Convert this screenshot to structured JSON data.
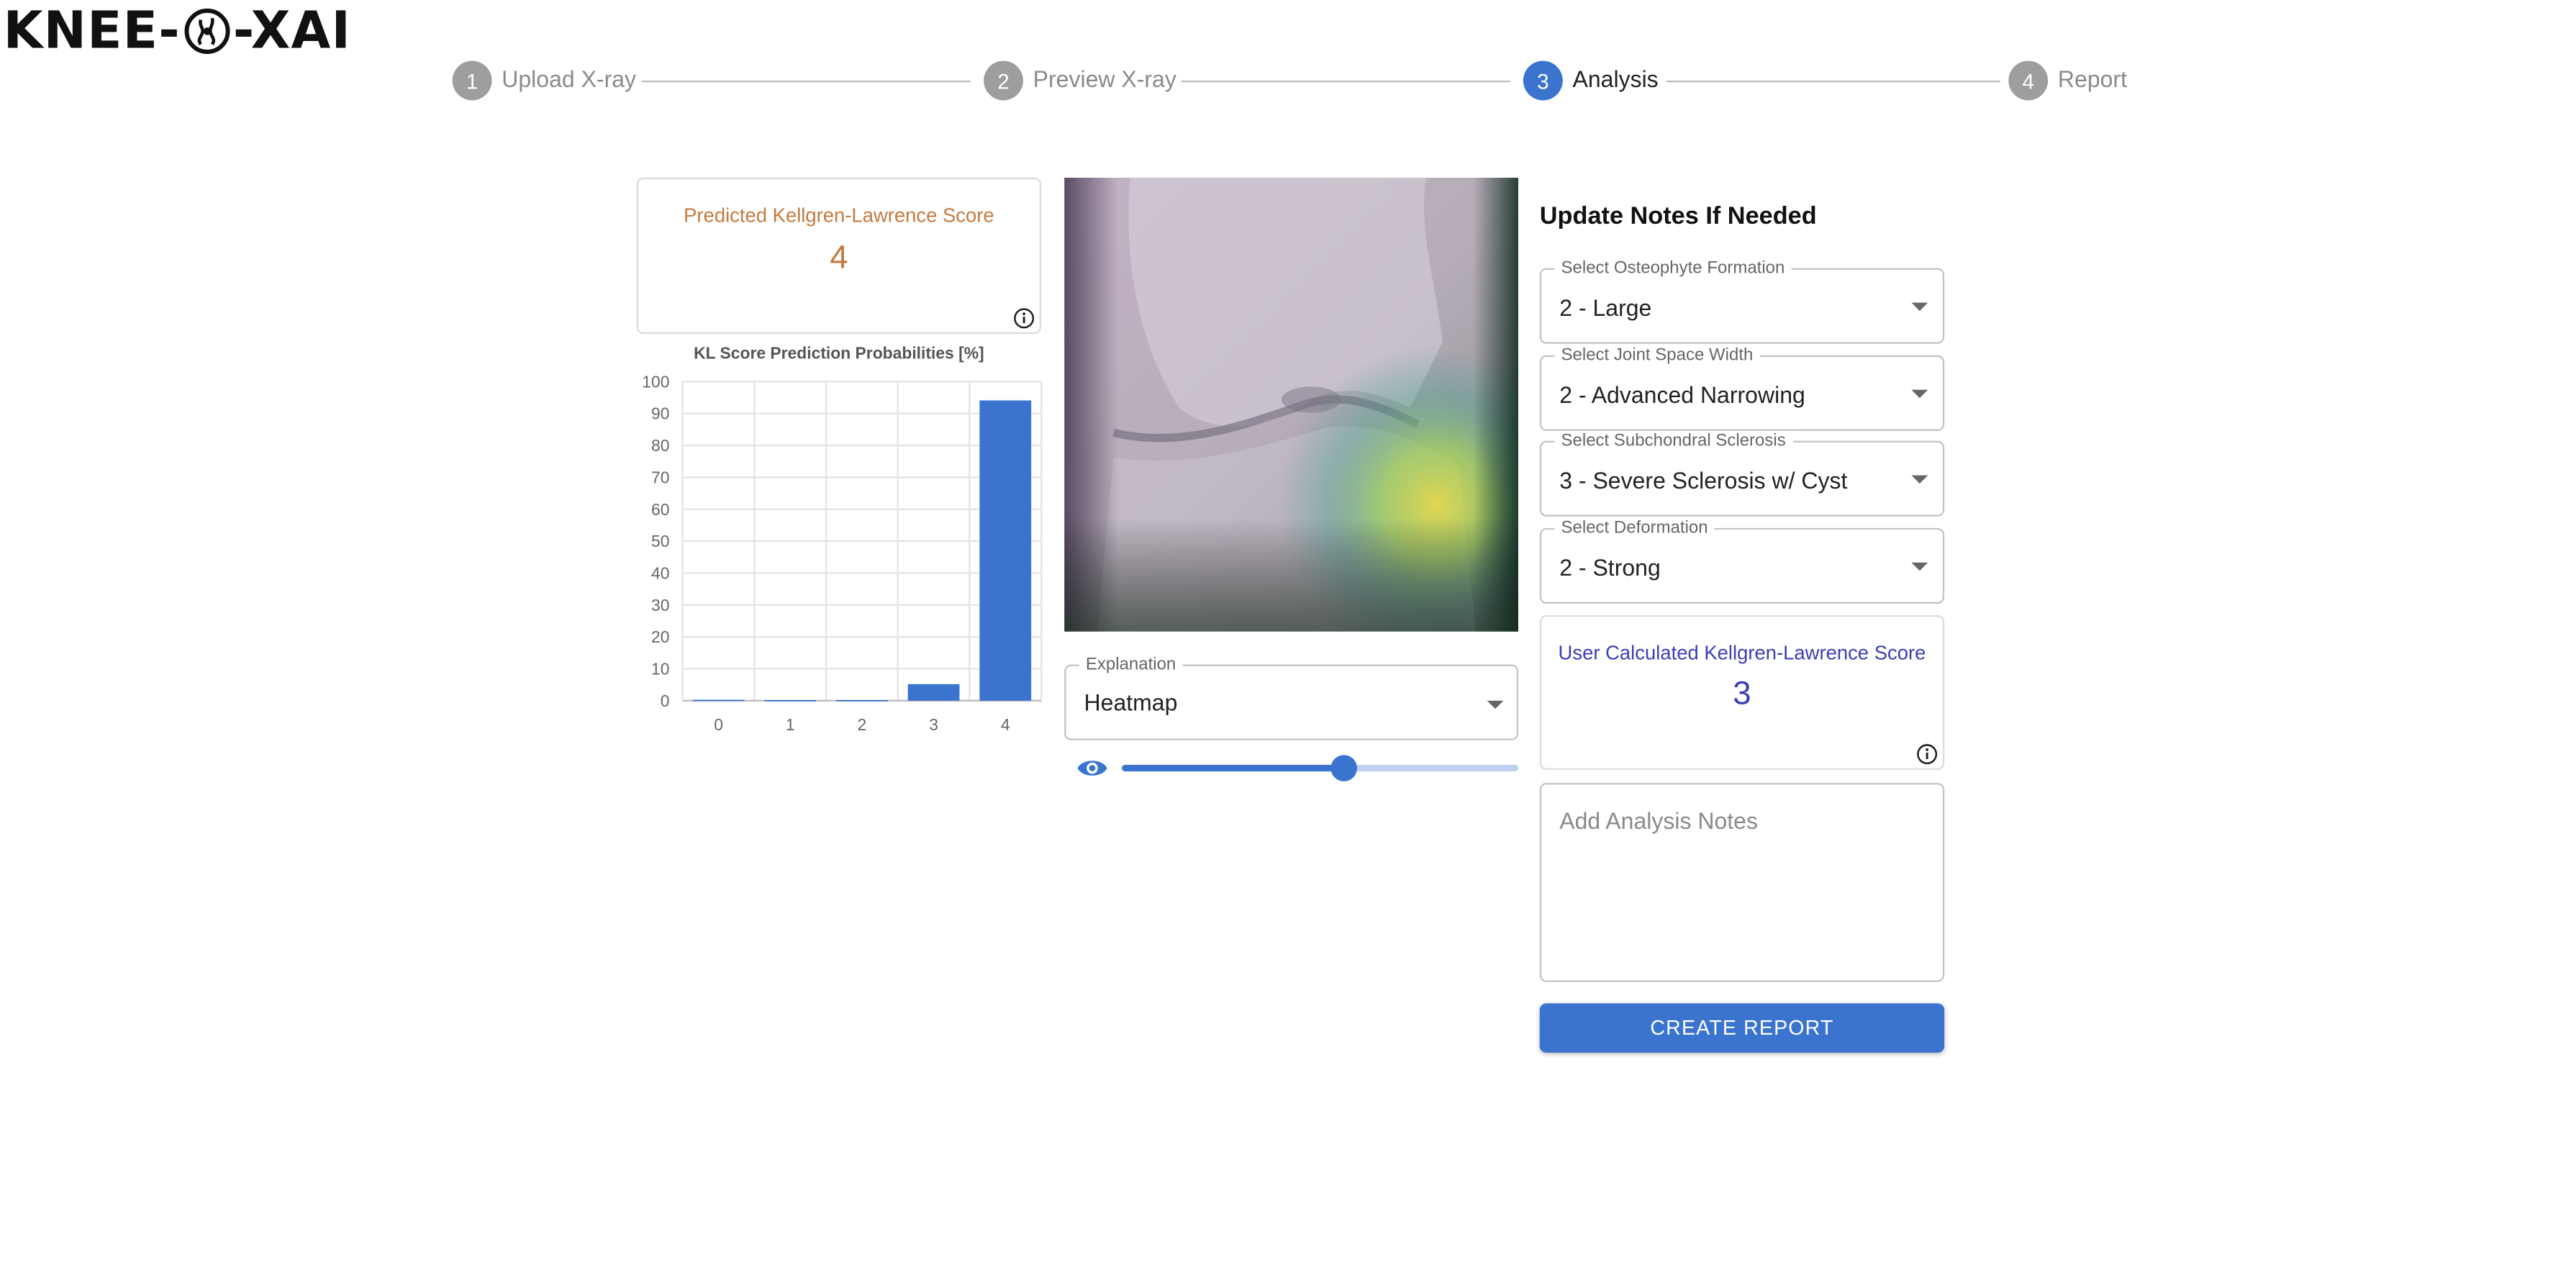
{
  "app": {
    "logo_left": "KNEE-",
    "logo_right": "-XAI"
  },
  "stepper": {
    "steps": [
      {
        "num": "1",
        "label": "Upload X-ray"
      },
      {
        "num": "2",
        "label": "Preview X-ray"
      },
      {
        "num": "3",
        "label": "Analysis"
      },
      {
        "num": "4",
        "label": "Report"
      }
    ],
    "active_step": 3
  },
  "prediction": {
    "title": "Predicted Kellgren-Lawrence Score",
    "value": "4",
    "color": "#c57a3e"
  },
  "chart_data": {
    "type": "bar",
    "title": "KL Score Prediction Probabilities [%]",
    "categories": [
      "0",
      "1",
      "2",
      "3",
      "4"
    ],
    "values": [
      0.3,
      0.2,
      0.2,
      5.2,
      94.1
    ],
    "ylim": [
      0,
      100
    ],
    "yticks": [
      0,
      10,
      20,
      30,
      40,
      50,
      60,
      70,
      80,
      90,
      100
    ],
    "grid": true,
    "bar_color": "#3a74cf",
    "xlabel": "",
    "ylabel": ""
  },
  "image_panel": {
    "explanation_label": "Explanation",
    "explanation_value": "Heatmap",
    "overlay_opacity": 0.56
  },
  "notes_panel": {
    "heading": "Update Notes If Needed",
    "selects": [
      {
        "label": "Select Osteophyte Formation",
        "value": "2 - Large"
      },
      {
        "label": "Select Joint Space Width",
        "value": "2 - Advanced Narrowing"
      },
      {
        "label": "Select Subchondral Sclerosis",
        "value": "3 - Severe Sclerosis w/ Cyst"
      },
      {
        "label": "Select Deformation",
        "value": "2 - Strong"
      }
    ],
    "user_score_title": "User Calculated Kellgren-Lawrence Score",
    "user_score_value": "3",
    "user_score_color": "#3b3fb4",
    "notes_placeholder": "Add Analysis Notes",
    "button_label": "CREATE REPORT"
  },
  "colors": {
    "accent": "#3a74cf",
    "inactive_step": "#9e9e9e"
  }
}
